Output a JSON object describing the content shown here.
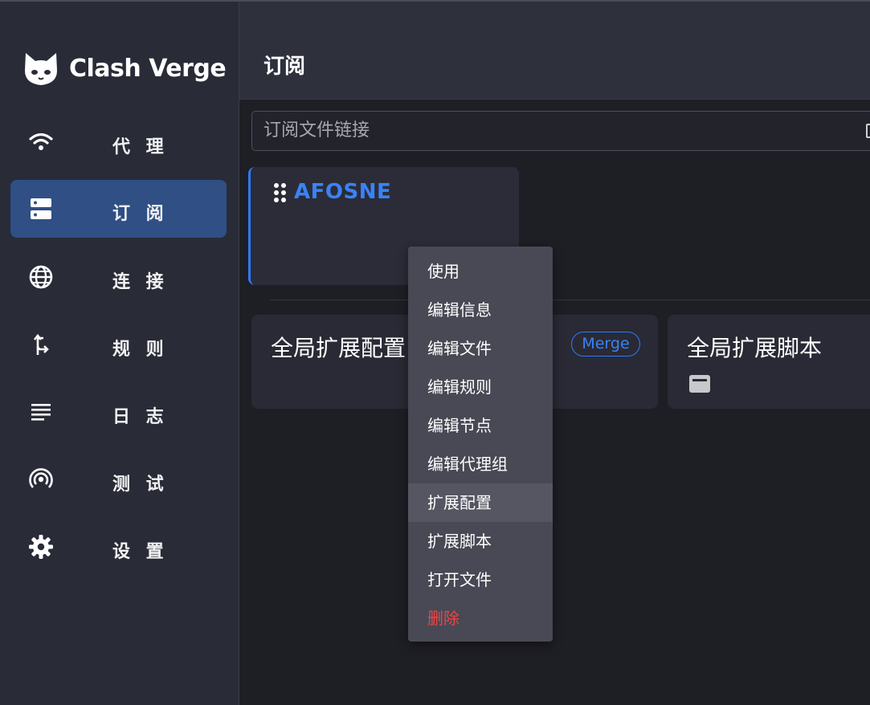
{
  "app": {
    "name": "Clash Verge"
  },
  "sidebar": {
    "items": [
      {
        "label": "代 理",
        "icon": "wifi-icon",
        "active": false
      },
      {
        "label": "订 阅",
        "icon": "dns-icon",
        "active": true
      },
      {
        "label": "连 接",
        "icon": "globe-icon",
        "active": false
      },
      {
        "label": "规 则",
        "icon": "fork-arrow-icon",
        "active": false
      },
      {
        "label": "日 志",
        "icon": "lines-icon",
        "active": false
      },
      {
        "label": "测 试",
        "icon": "broadcast-icon",
        "active": false
      },
      {
        "label": "设 置",
        "icon": "gear-icon",
        "active": false
      }
    ]
  },
  "header": {
    "title": "订阅"
  },
  "subscription": {
    "url_placeholder": "订阅文件链接"
  },
  "profile": {
    "name": "AFOSNE"
  },
  "extensions": {
    "merge": {
      "title": "全局扩展配置",
      "badge": "Merge"
    },
    "script": {
      "title": "全局扩展脚本"
    }
  },
  "context_menu": {
    "items": [
      {
        "label": "使用"
      },
      {
        "label": "编辑信息"
      },
      {
        "label": "编辑文件"
      },
      {
        "label": "编辑规则"
      },
      {
        "label": "编辑节点"
      },
      {
        "label": "编辑代理组"
      },
      {
        "label": "扩展配置",
        "hover": true
      },
      {
        "label": "扩展脚本"
      },
      {
        "label": "打开文件"
      },
      {
        "label": "删除",
        "danger": true
      }
    ]
  },
  "colors": {
    "accent": "#3b82f6",
    "active_nav_bg": "#2f4f85",
    "danger": "#ef4444",
    "sidebar_bg": "#292b37",
    "main_bg": "#1e1e25"
  }
}
